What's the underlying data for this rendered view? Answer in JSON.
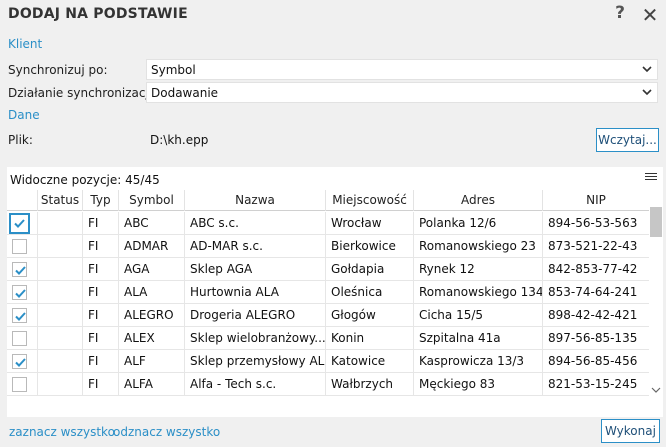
{
  "window": {
    "title": "DODAJ NA PODSTAWIE",
    "help_label": "?",
    "close_label": "✕"
  },
  "client_section": {
    "title": "Klient"
  },
  "sync_by": {
    "label": "Synchronizuj po:",
    "value": "Symbol"
  },
  "sync_action": {
    "label": "Działanie synchronizacji:",
    "value": "Dodawanie"
  },
  "data_section": {
    "title": "Dane"
  },
  "file": {
    "label": "Plik:",
    "value": "D:\\kh.epp",
    "browse_label": "Wczytaj..."
  },
  "grid": {
    "visible_count": "Widoczne pozycje: 45/45",
    "columns": [
      "",
      "Status",
      "Typ",
      "Symbol",
      "Nazwa",
      "Miejscowość",
      "Adres",
      "NIP"
    ],
    "rows": [
      {
        "checked": true,
        "status": "",
        "type": "FI",
        "symbol": "ABC",
        "name": "ABC s.c.",
        "city": "Wrocław",
        "address": "Polanka 12/6",
        "nip": "894-56-53-563"
      },
      {
        "checked": false,
        "status": "",
        "type": "FI",
        "symbol": "ADMAR",
        "name": "AD-MAR s.c.",
        "city": "Bierkowice",
        "address": "Romanowskiego 23",
        "nip": "873-521-22-43"
      },
      {
        "checked": true,
        "status": "",
        "type": "FI",
        "symbol": "AGA",
        "name": "Sklep AGA",
        "city": "Gołdapia",
        "address": "Rynek 12",
        "nip": "842-853-77-42"
      },
      {
        "checked": true,
        "status": "",
        "type": "FI",
        "symbol": "ALA",
        "name": "Hurtownia ALA",
        "city": "Oleśnica",
        "address": "Romanowskiego 134",
        "nip": "853-74-64-241"
      },
      {
        "checked": true,
        "status": "",
        "type": "FI",
        "symbol": "ALEGRO",
        "name": "Drogeria ALEGRO",
        "city": "Głogów",
        "address": "Cicha 15/5",
        "nip": "898-42-42-421"
      },
      {
        "checked": false,
        "status": "",
        "type": "FI",
        "symbol": "ALEX",
        "name": "Sklep wielobranżowy...",
        "city": "Konin",
        "address": "Szpitalna 41a",
        "nip": "897-56-85-135"
      },
      {
        "checked": true,
        "status": "",
        "type": "FI",
        "symbol": "ALF",
        "name": "Sklep przemysłowy ALF",
        "city": "Katowice",
        "address": "Kasprowicza 13/3",
        "nip": "894-56-85-456"
      },
      {
        "checked": false,
        "status": "",
        "type": "FI",
        "symbol": "ALFA",
        "name": "Alfa - Tech s.c.",
        "city": "Wałbrzych",
        "address": "Męckiego 83",
        "nip": "821-53-15-245"
      }
    ]
  },
  "footer": {
    "select_all": "zaznacz wszystko",
    "deselect_all": "odznacz wszystko",
    "execute_label": "Wykonaj"
  },
  "colors": {
    "accent": "#2b8fc7",
    "check": "#2b8fc7",
    "background": "#f0f0f0"
  }
}
